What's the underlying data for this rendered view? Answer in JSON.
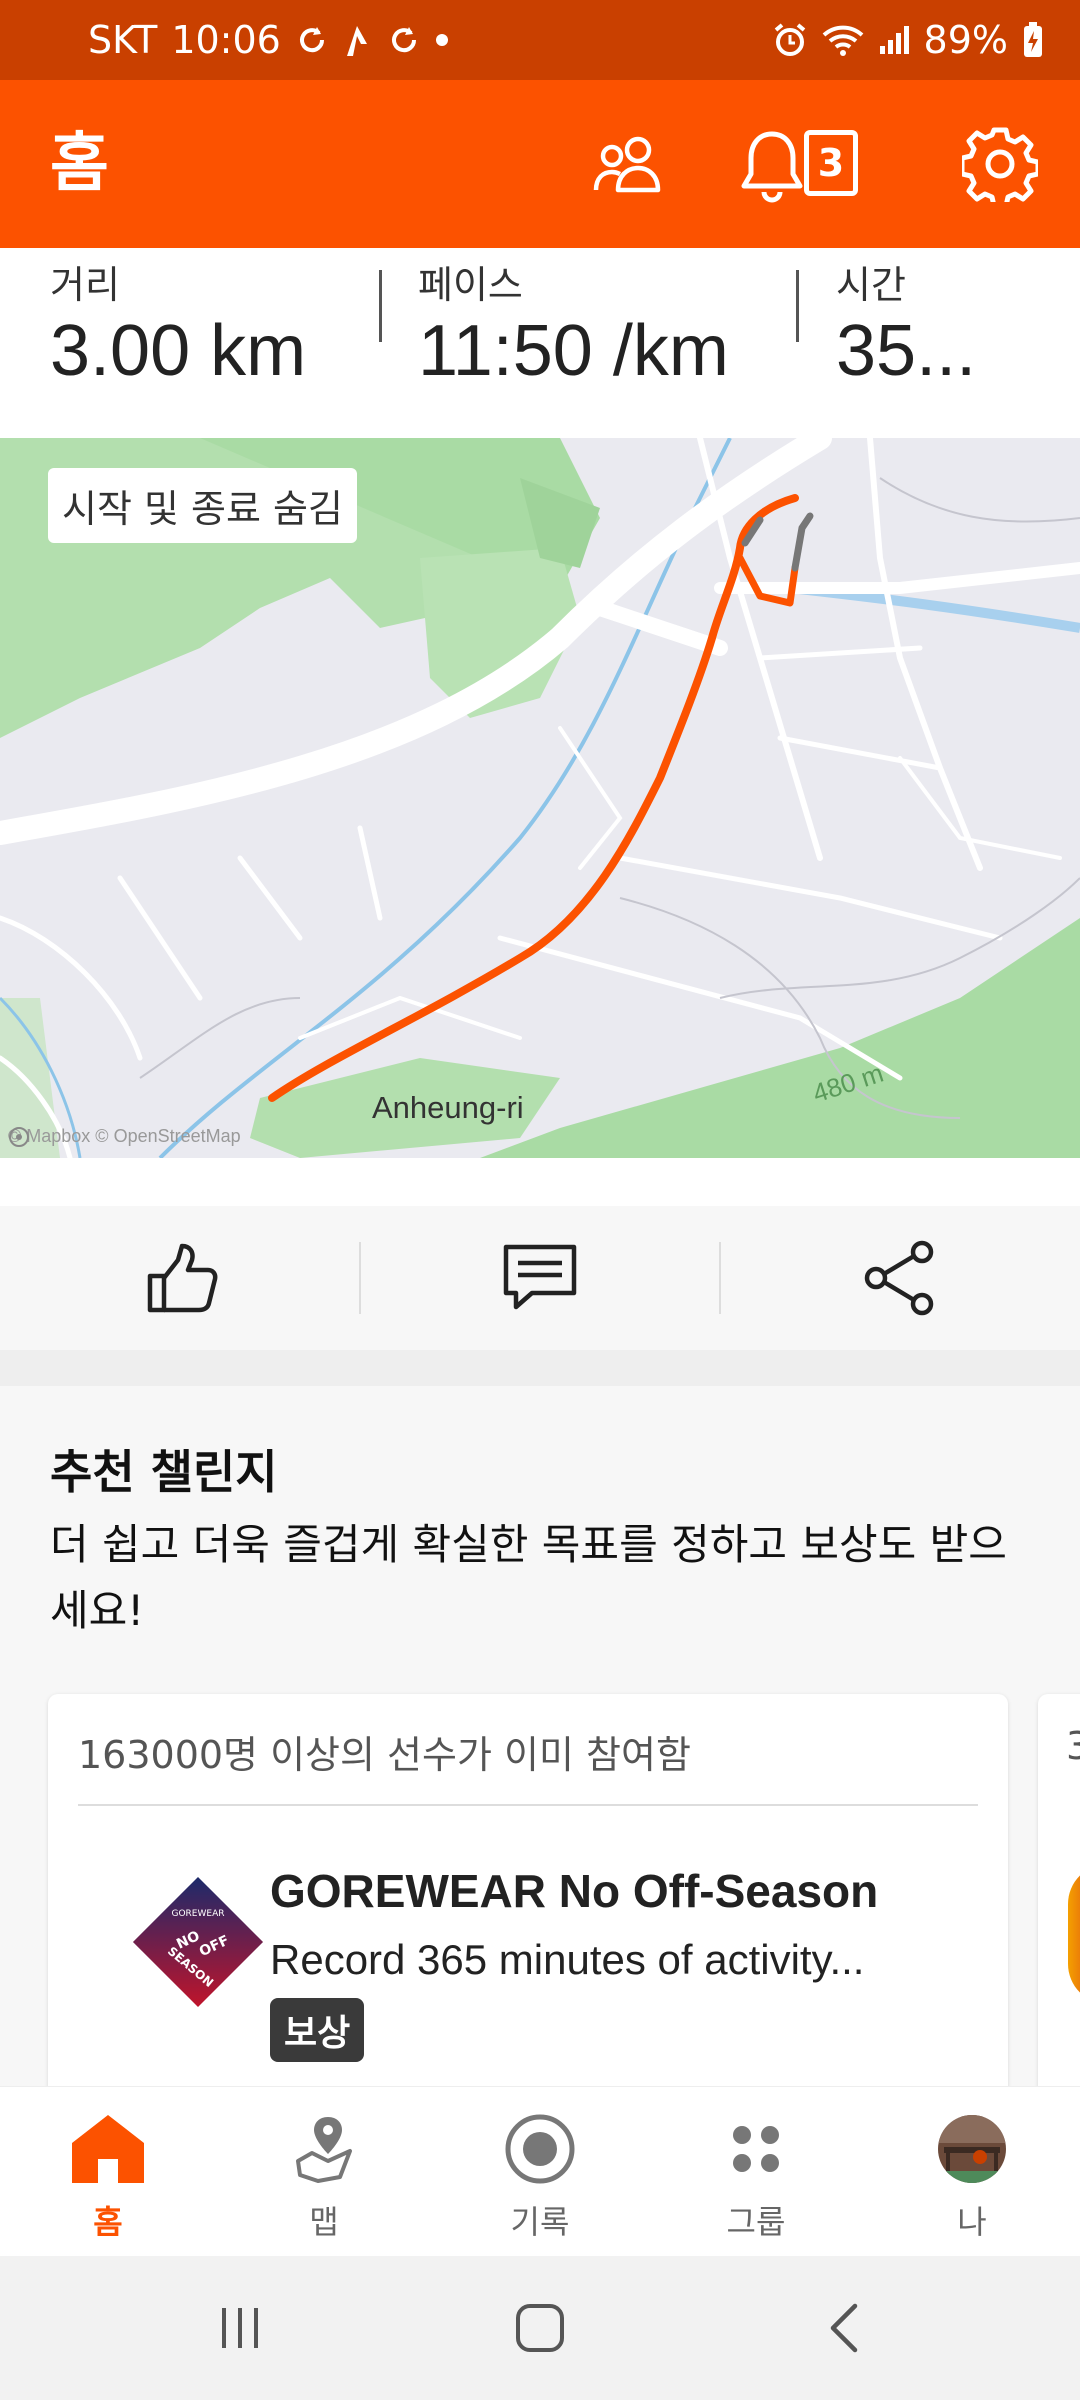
{
  "status_bar": {
    "carrier": "SKT",
    "time": "10:06",
    "battery": "89%"
  },
  "header": {
    "title": "홈",
    "notification_count": "3"
  },
  "stats": [
    {
      "label": "거리",
      "value": "3.00 km"
    },
    {
      "label": "페이스",
      "value": "11:50 /km"
    },
    {
      "label": "시간",
      "value": "35..."
    }
  ],
  "map": {
    "toggle_label": "시작 및 종료 숨김",
    "place_label": "Anheung-ri",
    "elevation_label": "480 m",
    "attribution": "© Mapbox © OpenStreetMap",
    "route_color": "#fc5200"
  },
  "challenges": {
    "title": "추천 챌린지",
    "subtitle": "더 쉽고 더욱 즐겁게 확실한 목표를 정하고 보상도 받으세요!",
    "cards": [
      {
        "participants": "163000명 이상의 선수가 이미 참여함",
        "name": "GOREWEAR No Off-Season",
        "description": "Record 365 minutes of activity...",
        "badge": "보상",
        "logo_text": [
          "GOREWEAR",
          "NO",
          "OFF",
          "SEASON"
        ]
      },
      {
        "participants": "3"
      }
    ]
  },
  "bottom_nav": [
    {
      "label": "홈",
      "icon": "home-icon",
      "active": true
    },
    {
      "label": "맵",
      "icon": "map-icon",
      "active": false
    },
    {
      "label": "기록",
      "icon": "record-icon",
      "active": false
    },
    {
      "label": "그룹",
      "icon": "groups-icon",
      "active": false
    },
    {
      "label": "나",
      "icon": "avatar",
      "active": false
    }
  ],
  "colors": {
    "brand": "#fc5200",
    "status_bar": "#c94000"
  }
}
